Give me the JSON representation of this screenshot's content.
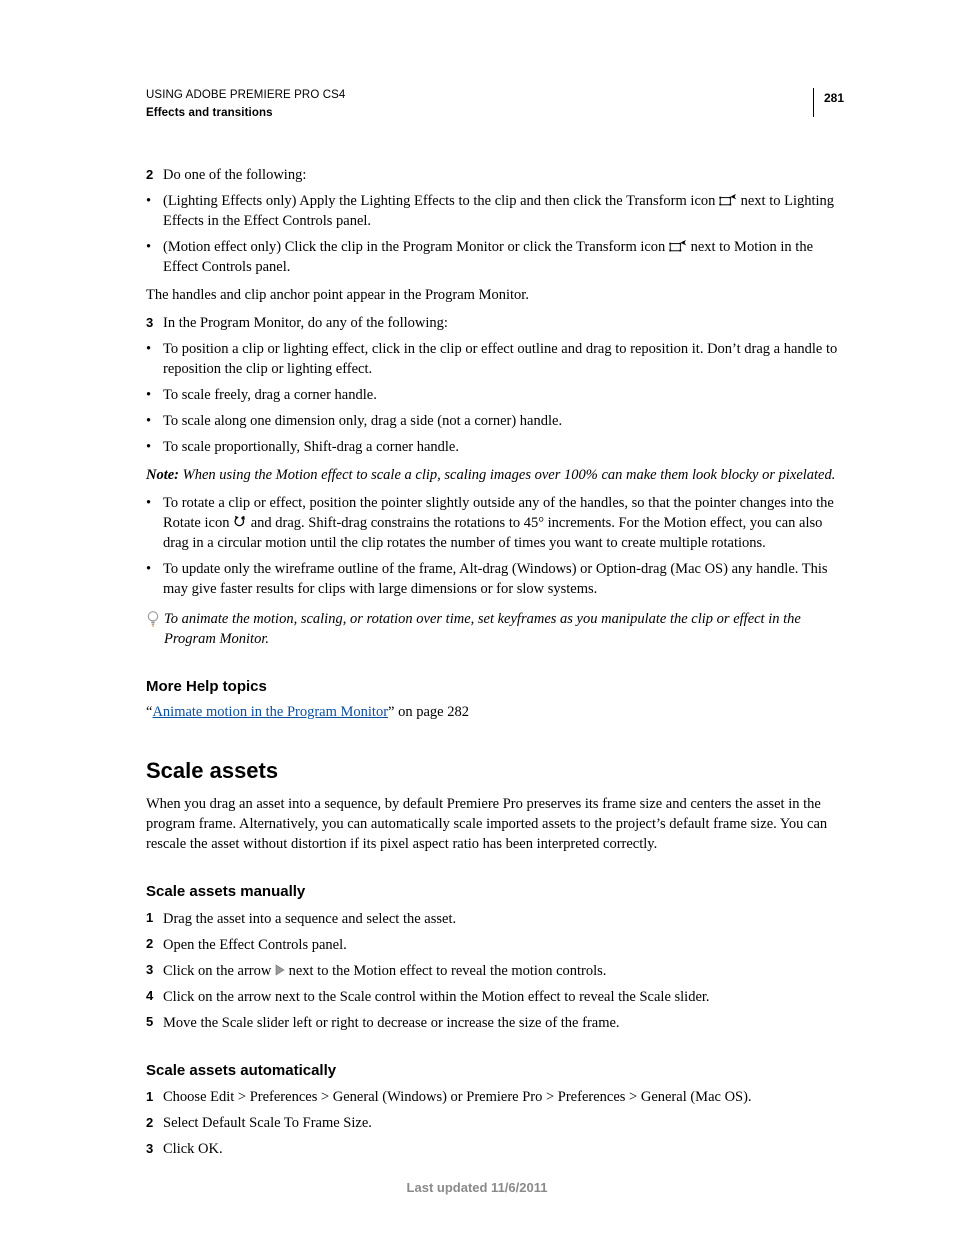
{
  "header": {
    "title": "USING ADOBE PREMIERE PRO CS4",
    "subtitle": "Effects and transitions",
    "page_number": "281"
  },
  "step2": {
    "num": "2",
    "text": "Do one of the following:"
  },
  "step2_bullets": [
    {
      "pre": "(Lighting Effects only) Apply the Lighting Effects to the clip and then click the Transform icon ",
      "post": " next to Lighting Effects in the Effect Controls panel."
    },
    {
      "pre": "(Motion effect only) Click the clip in the Program Monitor or click the Transform icon ",
      "post": " next to Motion in the Effect Controls panel."
    }
  ],
  "para_handles": "The handles and clip anchor point appear in the Program Monitor.",
  "step3": {
    "num": "3",
    "text": "In the Program Monitor, do any of the following:"
  },
  "step3_bullets_simple": [
    "To position a clip or lighting effect, click in the clip or effect outline and drag to reposition it. Don’t drag a handle to reposition the clip or lighting effect.",
    "To scale freely, drag a corner handle.",
    "To scale along one dimension only, drag a side (not a corner) handle.",
    "To scale proportionally, Shift-drag a corner handle."
  ],
  "note": {
    "label": "Note:",
    "text": " When using the Motion effect to scale a clip, scaling images over 100% can make them look blocky or pixelated."
  },
  "rotate_bullet": {
    "pre": "To rotate a clip or effect, position the pointer slightly outside any of the handles, so that the pointer changes into the Rotate icon ",
    "post": " and drag. Shift-drag constrains the rotations to 45° increments. For the Motion effect, you can also drag in a circular motion until the clip rotates the number of times you want to create multiple rotations."
  },
  "wire_bullet": "To update only the wireframe outline of the frame, Alt-drag (Windows) or Option-drag (Mac OS) any handle. This may give faster results for clips with large dimensions or for slow systems.",
  "tip": "To animate the motion, scaling, or rotation over time, set keyframes as you manipulate the clip or effect in the Program Monitor.",
  "more_help": {
    "heading": "More Help topics",
    "link_open": "“",
    "link_text": "Animate motion in the Program Monitor",
    "link_close": "” on page 282"
  },
  "section": {
    "title": "Scale assets",
    "intro": "When you drag an asset into a sequence, by default Premiere Pro preserves its frame size and centers the asset in the program frame. Alternatively, you can automatically scale imported assets to the project’s default frame size. You can rescale the asset without distortion if its pixel aspect ratio has been interpreted correctly."
  },
  "sub_manual": {
    "heading": "Scale assets manually",
    "steps": [
      {
        "num": "1",
        "text": "Drag the asset into a sequence and select the asset."
      },
      {
        "num": "2",
        "text": "Open the Effect Controls panel."
      },
      {
        "num": "3",
        "pre": "Click on the arrow ",
        "post": " next to the Motion effect to reveal the motion controls."
      },
      {
        "num": "4",
        "text": "Click on the arrow next to the Scale control within the Motion effect to reveal the Scale slider."
      },
      {
        "num": "5",
        "text": "Move the Scale slider left or right to decrease or increase the size of the frame."
      }
    ]
  },
  "sub_auto": {
    "heading": "Scale assets automatically",
    "steps": [
      {
        "num": "1",
        "text": "Choose Edit > Preferences > General (Windows) or Premiere Pro > Preferences > General (Mac OS)."
      },
      {
        "num": "2",
        "text": "Select Default Scale To Frame Size."
      },
      {
        "num": "3",
        "text": "Click OK."
      }
    ]
  },
  "footer": "Last updated 11/6/2011"
}
